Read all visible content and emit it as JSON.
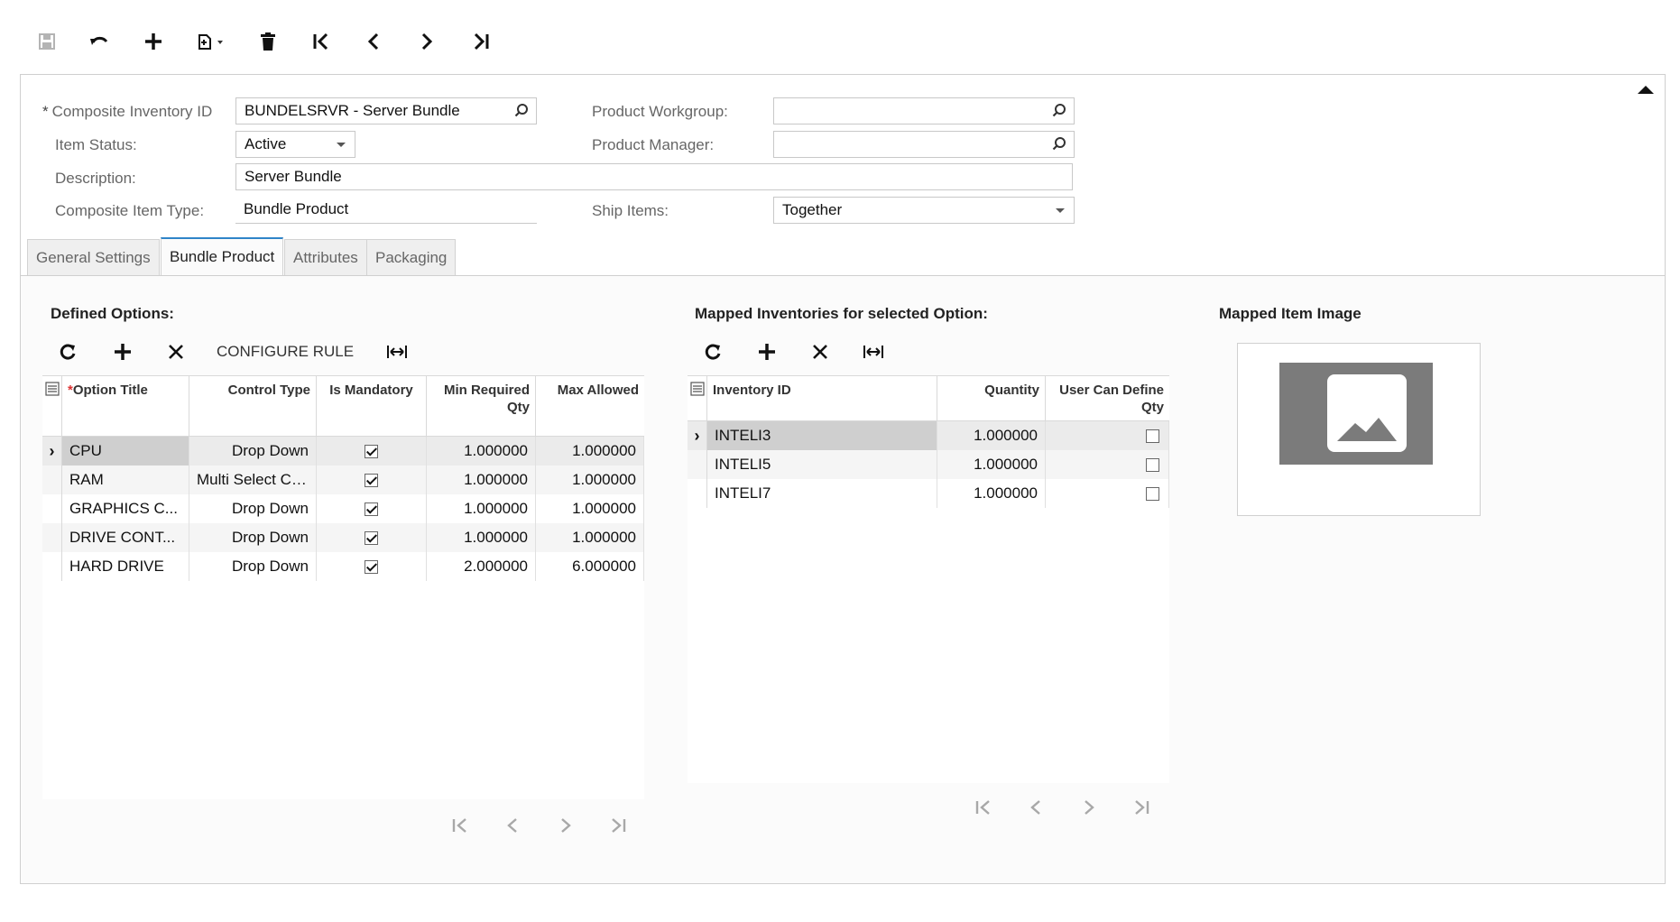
{
  "toolbar": {
    "icons": [
      "save-icon",
      "undo-icon",
      "add-icon",
      "copy-paste-icon",
      "delete-icon",
      "first-record-icon",
      "previous-record-icon",
      "next-record-icon",
      "last-record-icon"
    ]
  },
  "form": {
    "composite_inventory_id": {
      "label": "Composite Inventory ID",
      "value": "BUNDELSRVR - Server Bundle"
    },
    "item_status": {
      "label": "Item Status:",
      "value": "Active"
    },
    "description": {
      "label": "Description:",
      "value": "Server Bundle"
    },
    "composite_item_type": {
      "label": "Composite Item Type:",
      "value": "Bundle Product"
    },
    "product_workgroup": {
      "label": "Product Workgroup:",
      "value": ""
    },
    "product_manager": {
      "label": "Product Manager:",
      "value": ""
    },
    "ship_items": {
      "label": "Ship Items:",
      "value": "Together"
    }
  },
  "tabs": [
    {
      "label": "General Settings",
      "active": false
    },
    {
      "label": "Bundle Product",
      "active": true
    },
    {
      "label": "Attributes",
      "active": false
    },
    {
      "label": "Packaging",
      "active": false
    }
  ],
  "defined_options": {
    "title": "Defined Options:",
    "configure_rule_label": "CONFIGURE RULE",
    "columns": [
      "Option Title",
      "Control Type",
      "Is Mandatory",
      "Min Required Qty",
      "Max Allowed"
    ],
    "rows": [
      {
        "title": "CPU",
        "control_type": "Drop Down",
        "mandatory": true,
        "min_qty": "1.000000",
        "max_allowed": "1.000000",
        "selected": true
      },
      {
        "title": "RAM",
        "control_type": "Multi Select Com",
        "mandatory": true,
        "min_qty": "1.000000",
        "max_allowed": "1.000000",
        "selected": false
      },
      {
        "title": "GRAPHICS C...",
        "control_type": "Drop Down",
        "mandatory": true,
        "min_qty": "1.000000",
        "max_allowed": "1.000000",
        "selected": false
      },
      {
        "title": "DRIVE CONT...",
        "control_type": "Drop Down",
        "mandatory": true,
        "min_qty": "1.000000",
        "max_allowed": "1.000000",
        "selected": false
      },
      {
        "title": "HARD DRIVE",
        "control_type": "Drop Down",
        "mandatory": true,
        "min_qty": "2.000000",
        "max_allowed": "6.000000",
        "selected": false
      }
    ]
  },
  "mapped_inventories": {
    "title": "Mapped Inventories for selected Option:",
    "columns": [
      "Inventory ID",
      "Quantity",
      "User Can Define Qty"
    ],
    "rows": [
      {
        "inventory_id": "INTELI3",
        "quantity": "1.000000",
        "user_can_define": false,
        "selected": true
      },
      {
        "inventory_id": "INTELI5",
        "quantity": "1.000000",
        "user_can_define": false,
        "selected": false
      },
      {
        "inventory_id": "INTELI7",
        "quantity": "1.000000",
        "user_can_define": false,
        "selected": false
      }
    ]
  },
  "mapped_item_image": {
    "title": "Mapped Item Image",
    "icon": "image-placeholder-icon"
  },
  "colors": {
    "tab_accent": "#2f84c8",
    "image_placeholder": "#7b7b7b"
  }
}
